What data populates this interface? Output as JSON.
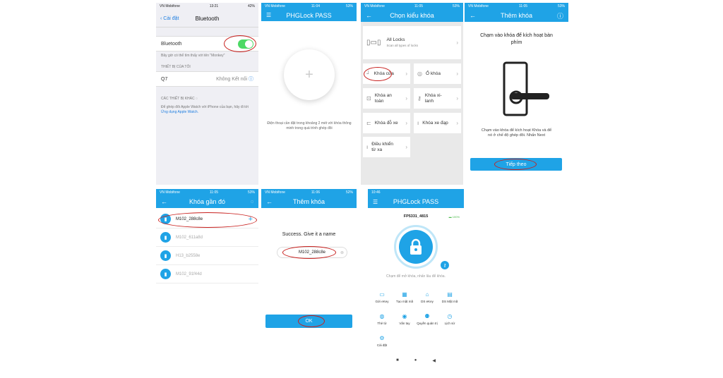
{
  "bluetooth": {
    "carrier": "VN Mobifone",
    "time": "13:21",
    "battery": "42%",
    "back": "Cài đặt",
    "title": "Bluetooth",
    "toggle_label": "Bluetooth",
    "discover_note": "Bây giờ có thể tìm thấy với tên \"Monkey\"",
    "my_devices": "THIẾT BỊ CỦA TÔI",
    "device_name": "Q7",
    "device_status": "Không Kết nối",
    "other_devices": "CÁC THIẾT BỊ KHÁC",
    "watch_note": "Để ghép đôi Apple Watch với iPhone của bạn, hãy đi tới",
    "watch_link": "Ứng dụng Apple Watch."
  },
  "app_home": {
    "carrier": "VN Mobifone",
    "time": "11:04",
    "battery": "53%",
    "title": "PHGLock PASS",
    "add_symbol": "+",
    "hint": "Điện thoại cần đặt trong khoảng 2 mét với khóa thông minh trong quá trình ghép đôi"
  },
  "lock_type": {
    "carrier": "VN Mobifone",
    "time": "11:05",
    "battery": "53%",
    "title": "Chọn kiểu khóa",
    "all_locks": "All Locks",
    "all_locks_sub": "Scan all types of locks",
    "types": [
      "Khóa cửa",
      "Ổ khóa",
      "Khóa an toàn",
      "Khóa xi-lanh",
      "Khóa đỗ xe",
      "Khóa xe đạp",
      "Điều khiển từ xa"
    ]
  },
  "add_lock": {
    "carrier": "VN Mobifone",
    "time": "11:05",
    "battery": "53%",
    "title": "Thêm khóa",
    "heading": "Chạm vào khóa để kích hoạt bàn phím",
    "instructions": "Chạm vào khóa để kích hoạt Khóa và để nó ở chế độ ghép đôi. Nhấn Next",
    "next_button": "Tiếp theo"
  },
  "nearby": {
    "carrier": "VN Mobifone",
    "time": "11:05",
    "battery": "53%",
    "title": "Khóa gần đó",
    "devices": [
      "M102_288c8e",
      "M102_611a8d",
      "H13_b2558e",
      "M102_91f44d"
    ]
  },
  "name_lock": {
    "carrier": "VN Mobifone",
    "time": "11:06",
    "battery": "52%",
    "title": "Thêm khóa",
    "success": "Success. Give it a name",
    "lock_name": "M102_288c8e",
    "ok_button": "OK"
  },
  "lock_home": {
    "time": "10:46",
    "title": "PHGLock PASS",
    "lock_id": "FP5331_4815",
    "battery_pct": "100%",
    "hint": "Chạm để mở khóa, nhấn lâu để khóa.",
    "actions": [
      "Gửi eKey",
      "Tạo mật mã",
      "DS eKey",
      "DS Mật mã",
      "Thẻ từ",
      "Vân tay",
      "Quyền quản trị",
      "Lịch sử",
      "Cài đặt"
    ]
  },
  "colors": {
    "brand": "#1fa3e6",
    "highlight": "#c8201e",
    "ios_green": "#4cd964"
  }
}
